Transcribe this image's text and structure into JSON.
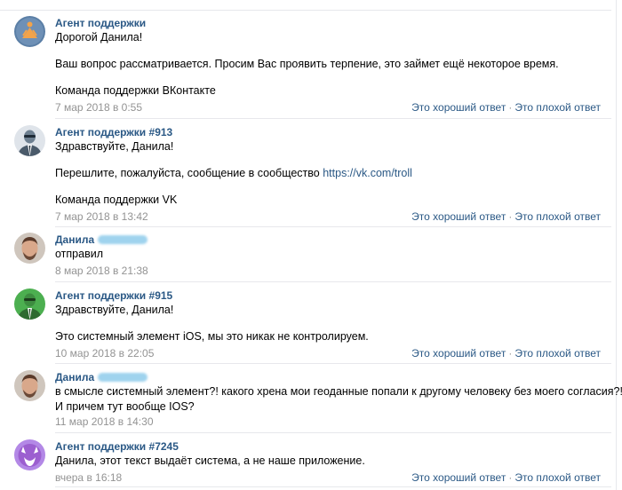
{
  "messages": [
    {
      "author": "Агент поддержки",
      "lines": [
        "Дорогой Данила!",
        "",
        "Ваш вопрос рассматривается. Просим Вас проявить терпение, это займет ещё некоторое время.",
        "",
        "Команда поддержки ВКонтакте"
      ],
      "date": "7 мар 2018 в 0:55",
      "good": "Это хороший ответ",
      "bad": "Это плохой ответ"
    },
    {
      "author": "Агент поддержки #913",
      "line1": "Здравствуйте, Данила!",
      "line2": "Перешлите, пожалуйста, сообщение в сообщество",
      "link": "https://vk.com/troll",
      "line3": "Команда поддержки VK",
      "date": "7 мар 2018 в 13:42",
      "good": "Это хороший ответ",
      "bad": "Это плохой ответ"
    },
    {
      "author": "Данила",
      "lines": [
        "отправил"
      ],
      "date": "8 мар 2018 в 21:38"
    },
    {
      "author": "Агент поддержки #915",
      "lines": [
        "Здравствуйте, Данила!",
        "",
        "Это системный элемент iOS, мы это никак не контролируем."
      ],
      "date": "10 мар 2018 в 22:05",
      "good": "Это хороший ответ",
      "bad": "Это плохой ответ"
    },
    {
      "author": "Данила",
      "lines": [
        "в смысле системный элемент?! какого хрена мои геоданные попали к другому человеку без моего согласия?!",
        "И причем тут вообще IOS?"
      ],
      "date": "11 мар 2018 в 14:30"
    },
    {
      "author": "Агент поддержки #7245",
      "lines": [
        "Данила, этот текст выдаёт система, а не наше приложение."
      ],
      "date": "вчера в 16:18",
      "good": "Это хороший ответ",
      "bad": "Это плохой ответ"
    }
  ],
  "separator_dot": "·",
  "colors": {
    "link": "#2a5885",
    "muted": "#939393",
    "divider": "#e7e8ec",
    "agent_orange": "#f2a34a",
    "agent_slate": "#6d7f90",
    "agent_green": "#3d8c40",
    "agent_purple": "#9c5fd0"
  }
}
